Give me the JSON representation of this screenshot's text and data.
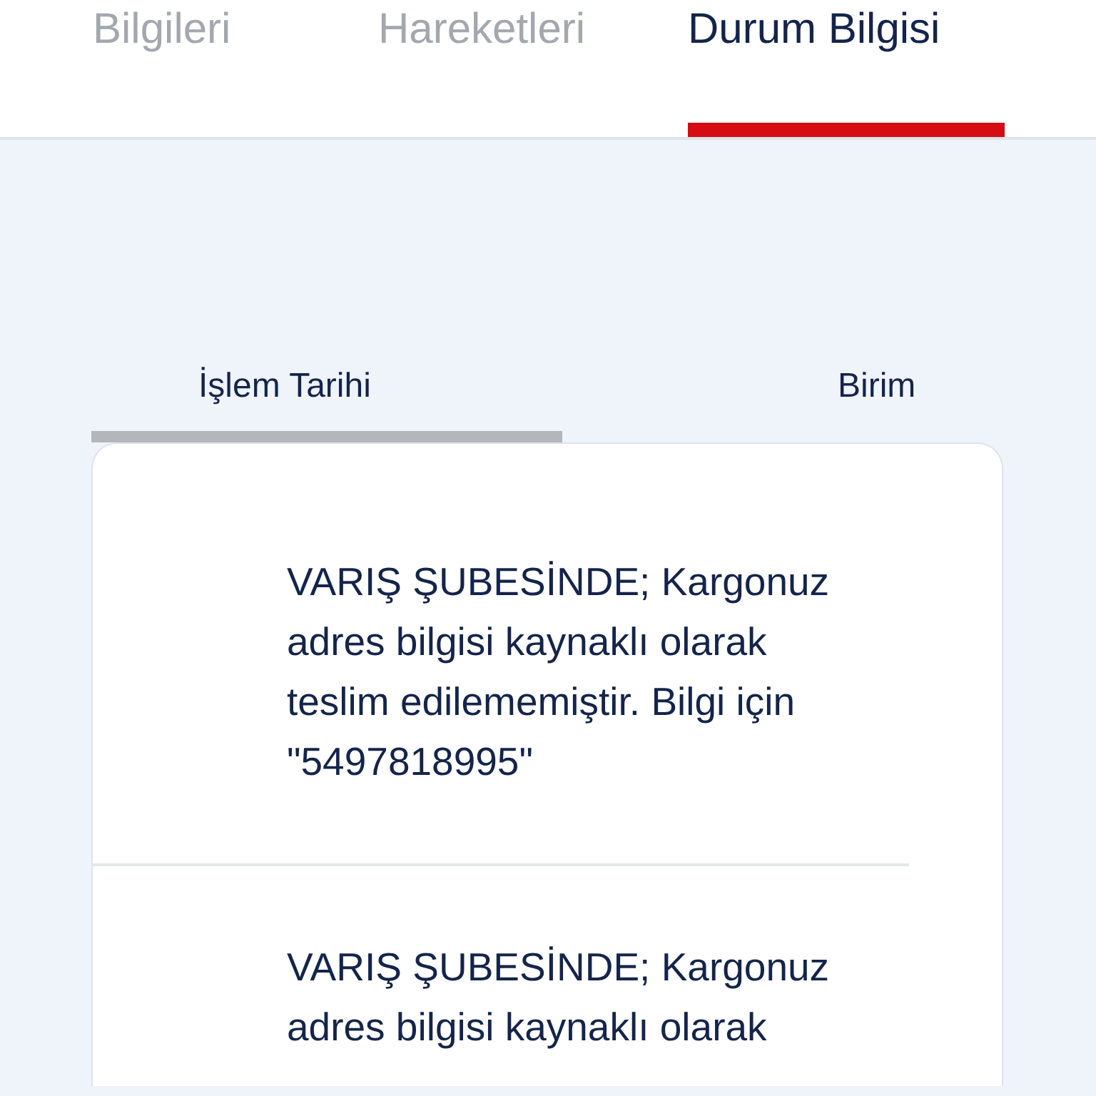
{
  "tabs": [
    {
      "label": "Bilgileri",
      "selected": false
    },
    {
      "label": "Hareketleri",
      "selected": false
    },
    {
      "label": "Durum Bilgisi",
      "selected": true
    }
  ],
  "section_tabs": [
    {
      "label": "İşlem Tarihi",
      "selected": true
    },
    {
      "label": "Birim",
      "selected": false
    }
  ],
  "events": [
    {
      "description": "VARIŞ ŞUBESİNDE; Kargonuz adres bilgisi kaynaklı olarak teslim edilememiştir. Bilgi için \"5497818995\""
    },
    {
      "description": "VARIŞ ŞUBESİNDE; Kargonuz adres bilgisi kaynaklı olarak"
    }
  ]
}
